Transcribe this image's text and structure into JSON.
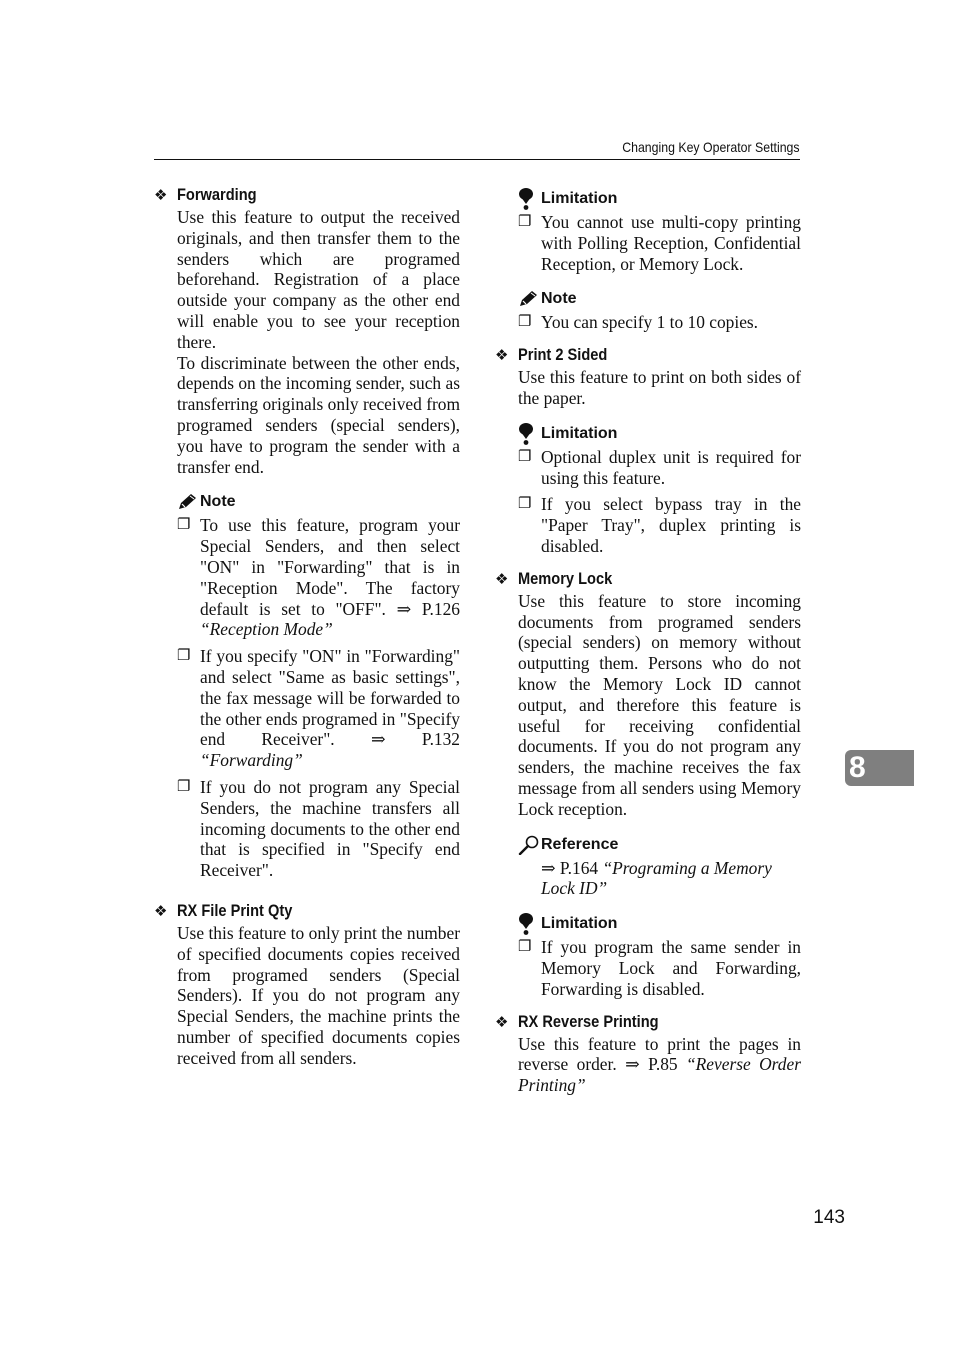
{
  "header": {
    "title": "Changing Key Operator Settings"
  },
  "chapter_tab": "8",
  "page_number": "143",
  "icons": {
    "section": "diamond-bullet-icon",
    "limitation": "limitation-exclamation-icon",
    "note": "note-pencil-icon",
    "reference": "reference-magnifier-icon",
    "bullet": "checkbox-bullet-icon"
  },
  "left": {
    "forwarding": {
      "title": "Forwarding",
      "para1": "Use this feature to output the received originals, and then transfer them to the senders which are programed beforehand. Registration of a place outside your company as the other end will enable you to see your reception there.",
      "para2": "To discriminate between the other ends, depends on the incoming sender, such as transferring originals only received from programed senders (special senders), you have to program the sender with a transfer end.",
      "note_label": "Note",
      "notes": [
        {
          "text": "To use this feature, program your Special Senders, and then select \"ON\" in \"Forwarding\" that is in \"Reception Mode\". The factory default is set to \"OFF\". ⇒ P.126 ",
          "ref": "“Reception Mode”"
        },
        {
          "text": "If you specify \"ON\" in \"Forwarding\" and select \"Same as basic settings\", the fax message will be forwarded to the other ends programed in \"Specify end Receiver\". ⇒ P.132 ",
          "ref": "“Forwarding”"
        },
        {
          "text": "If you do not program any Special Senders, the machine transfers all incoming documents to the other end that is specified in \"Specify end Receiver\".",
          "ref": ""
        }
      ]
    },
    "rx_file_print_qty": {
      "title": "RX File Print Qty",
      "para": "Use this feature to only print the number of specified documents copies received from programed senders (Special Senders). If you do not program any Special Senders, the machine prints the number of specified documents copies received from all senders."
    }
  },
  "right": {
    "rx_file_limitation": {
      "label": "Limitation",
      "items": [
        "You cannot use multi-copy printing with Polling Reception, Confidential Reception, or Memory Lock."
      ]
    },
    "rx_file_note": {
      "label": "Note",
      "items": [
        "You can specify 1 to 10 copies."
      ]
    },
    "print_2_sided": {
      "title": "Print 2 Sided",
      "para": "Use this feature to print on both sides of the paper.",
      "limitation_label": "Limitation",
      "limitations": [
        "Optional duplex unit is required for using this feature.",
        "If you select bypass tray in the \"Paper Tray\", duplex printing is disabled."
      ]
    },
    "memory_lock": {
      "title": "Memory Lock",
      "para": "Use this feature to store incoming documents from programed senders (special senders) on memory without outputting them. Persons who do not know the Memory Lock ID cannot output, and therefore this feature is useful for receiving confidential documents. If you do not program any senders, the machine receives the fax message from all senders using Memory Lock reception.",
      "reference_label": "Reference",
      "reference_prefix": "⇒ P.164 ",
      "reference_title": "“Programing a Memory Lock ID”",
      "limitation_label": "Limitation",
      "limitations": [
        "If you program the same sender in Memory Lock and Forwarding, Forwarding is disabled."
      ]
    },
    "rx_reverse_printing": {
      "title": "RX Reverse Printing",
      "para_prefix": "Use this feature to print the pages in reverse order. ⇒ P.85 ",
      "para_ref": "“Reverse Order Printing”"
    }
  }
}
